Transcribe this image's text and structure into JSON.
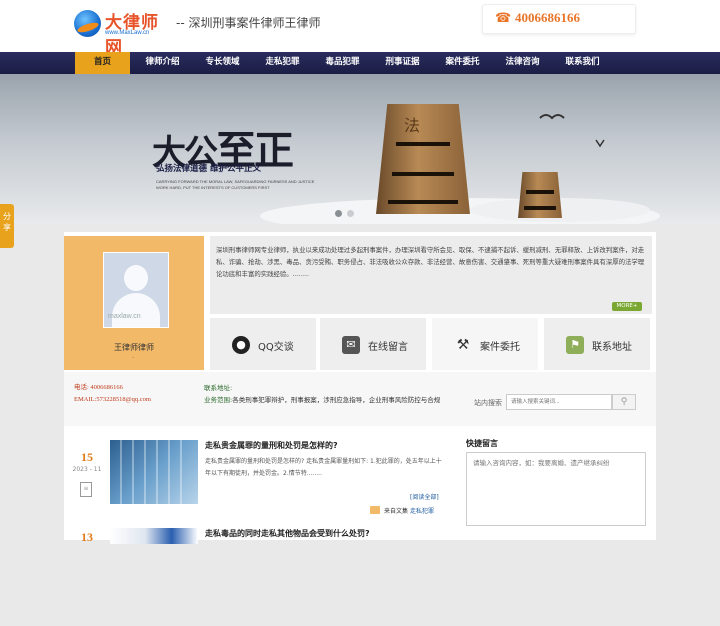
{
  "header": {
    "logo_name": "大律师网",
    "logo_url": "www.MaxLaw.cn",
    "site_title": "-- 深圳刑事案件律师王律师",
    "phone": "4006686166"
  },
  "nav": {
    "items": [
      "首页",
      "律师介绍",
      "专长领域",
      "走私犯罪",
      "毒品犯罪",
      "刑事证据",
      "案件委托",
      "法律咨询",
      "联系我们"
    ]
  },
  "banner": {
    "slogan_big_a": "大公",
    "slogan_big_b": "至正",
    "slogan_sub": "弘扬法律道德  维护公平正义",
    "slogan_en_1": "CARRYING FORWARD THE MORAL LAW, SAFEGUARDING FAIRNESS AND JUSTICE",
    "slogan_en_2": "WORK HARD, PUT THE INTERESTS OF CUSTOMERS FIRST",
    "tower_char": "法"
  },
  "share_tab": "分享",
  "profile": {
    "avatar_watermark": "maxlaw.cn",
    "name": "王律师律师",
    "dot": "."
  },
  "intro": {
    "text": "深圳刑事律师网专业律师，执业以来成功处理过多起刑事案件，办理深圳看守所会见、取保、不逮捕不起诉、缓刑减刑、无罪释放、上诉改判案件，对走私、诈骗、抢劫、涉黑、毒品、贪污受贿、职务侵占、非法吸收公众存款、非法经营、故意伤害、交通肇事、死刑等重大疑难刑事案件具有深厚的法学理论功底和丰富的实践经验。........",
    "more_label": "MORE+"
  },
  "actions": [
    {
      "label": "QQ交谈",
      "icon": "qq-penguin-icon"
    },
    {
      "label": "在线留言",
      "icon": "chat-bubble-icon"
    },
    {
      "label": "案件委托",
      "icon": "gavel-icon"
    },
    {
      "label": "联系地址",
      "icon": "map-icon"
    }
  ],
  "contact": {
    "phone_line": "电话: 4006686166",
    "email_line": "EMAIL:573228518@qq.com",
    "address_label": "联系地址:",
    "scope_label": "业务范围:",
    "scope_value": "各类刑事犯罪辩护，刑事报案，涉刑应急指导，企业刑事风险防控与合规"
  },
  "search": {
    "label": "站内搜索",
    "placeholder": "请输入搜索关键词..."
  },
  "articles": [
    {
      "day": "15",
      "year_month": "2023 - 11",
      "title": "走私贵金属罪的量刑和处罚是怎样的?",
      "summary": "走私贵金属罪的量刑和处罚是怎样的? 走私贵金属罪量刑如下: 1.犯此罪的，处五年以上十年以下有期徒刑，并处罚金。2.情节特........",
      "more": "[阅读全部]",
      "category": "来自文集",
      "category_link": "走私犯罪"
    },
    {
      "day": "13",
      "title": "走私毒品的同时走私其他物品会受到什么处罚?"
    }
  ],
  "message": {
    "title": "快捷留言",
    "placeholder": "请输入咨询内容，如：我要离婚、遗产继承纠纷"
  }
}
